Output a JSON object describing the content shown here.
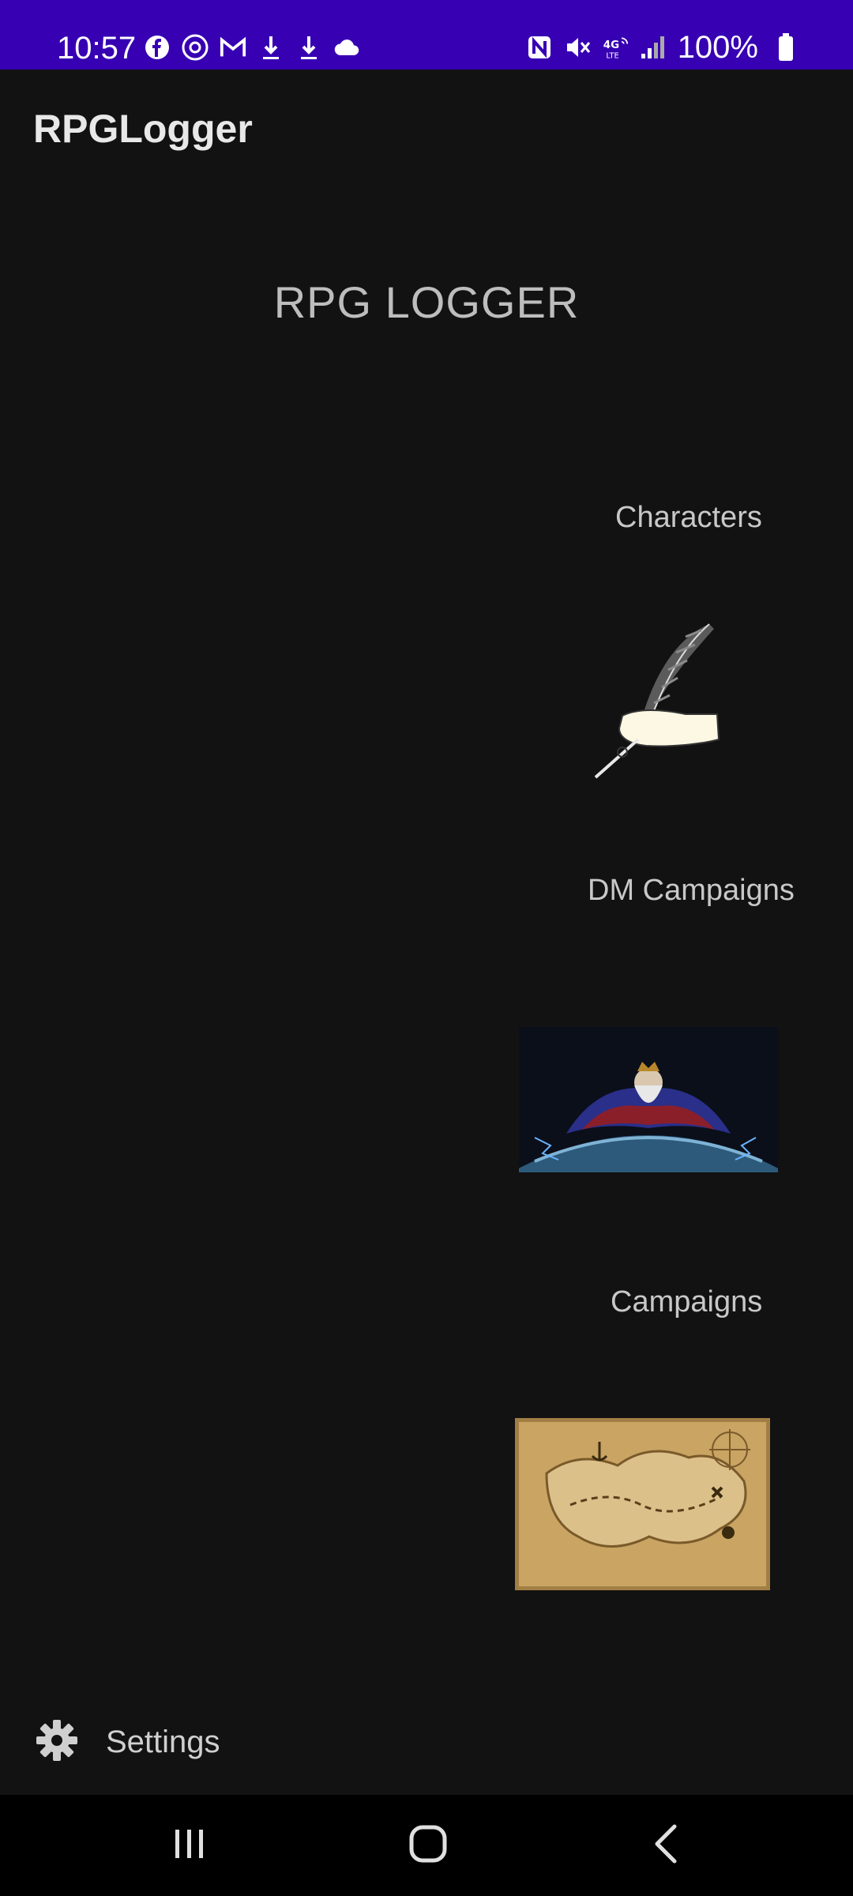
{
  "status_bar": {
    "time": "10:57",
    "left_icons": [
      "facebook-icon",
      "threads-icon",
      "gmail-icon",
      "download-icon",
      "download-icon",
      "cloud-icon"
    ],
    "right_icons": [
      "nfc-icon",
      "mute-icon",
      "lte-icon",
      "signal-icon"
    ],
    "battery": "100%",
    "color": "#3700b3"
  },
  "app_bar": {
    "title": "RPGLogger"
  },
  "main": {
    "title": "RPG LOGGER",
    "sections": [
      {
        "label": "Characters",
        "image": "quill-hand-image"
      },
      {
        "label": "DM Campaigns",
        "image": "wizard-over-world-image"
      },
      {
        "label": "Campaigns",
        "image": "treasure-map-image"
      }
    ]
  },
  "settings": {
    "label": "Settings",
    "icon": "gear-icon"
  },
  "nav_bar": {
    "buttons": [
      "recents-icon",
      "home-icon",
      "back-icon"
    ]
  },
  "colors": {
    "background": "#121212",
    "text": "#cfcfcf"
  }
}
